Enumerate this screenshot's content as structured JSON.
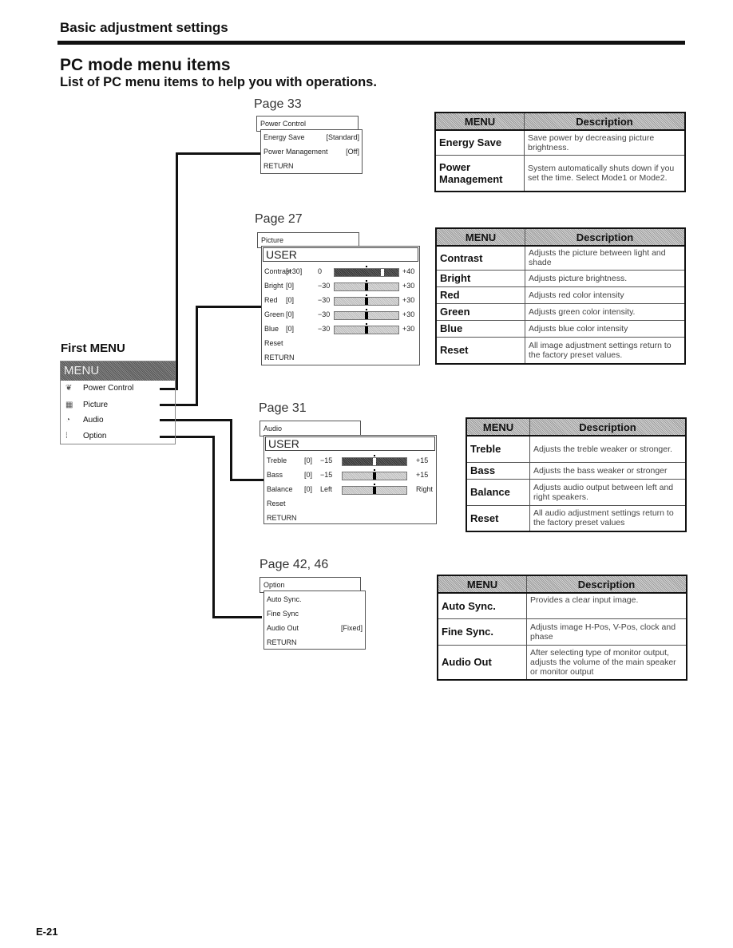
{
  "header": {
    "section": "Basic adjustment settings",
    "title": "PC mode menu items",
    "subtitle": "List of PC menu items to help you with operations."
  },
  "first_menu": {
    "label": "First MENU",
    "head": "MENU",
    "items": [
      {
        "icon": "power-control-icon",
        "glyph": "❦",
        "label": "Power Control"
      },
      {
        "icon": "picture-icon",
        "glyph": "▦",
        "label": "Picture"
      },
      {
        "icon": "audio-icon",
        "glyph": "◔",
        "label": "Audio"
      },
      {
        "icon": "option-icon",
        "glyph": "⁞",
        "label": "Option"
      }
    ]
  },
  "power_control": {
    "page": "Page 33",
    "title": "Power Control",
    "rows": [
      {
        "label": "Energy Save",
        "value": "[Standard]"
      },
      {
        "label": "Power Management",
        "value": "[Off]"
      },
      {
        "label": "RETURN",
        "value": ""
      }
    ],
    "table": {
      "headers": [
        "MENU",
        "Description"
      ],
      "rows": [
        {
          "menu": "Energy Save",
          "desc": "Save power by decreasing picture brightness."
        },
        {
          "menu": "Power Management",
          "desc": "System automatically shuts down if you set the time. Select Mode1 or Mode2."
        }
      ]
    }
  },
  "picture": {
    "page": "Page 27",
    "title": "Picture",
    "mode": "USER",
    "sliders": [
      {
        "label": "Contrast",
        "value": "[+30]",
        "min": "0",
        "max": "+40",
        "fraction": 0.75,
        "selected": true
      },
      {
        "label": "Bright",
        "value": "[0]",
        "min": "−30",
        "max": "+30",
        "fraction": 0.5,
        "selected": false
      },
      {
        "label": "Red",
        "value": "[0]",
        "min": "−30",
        "max": "+30",
        "fraction": 0.5,
        "selected": false
      },
      {
        "label": "Green",
        "value": "[0]",
        "min": "−30",
        "max": "+30",
        "fraction": 0.5,
        "selected": false
      },
      {
        "label": "Blue",
        "value": "[0]",
        "min": "−30",
        "max": "+30",
        "fraction": 0.5,
        "selected": false
      }
    ],
    "extra": [
      "Reset",
      "RETURN"
    ],
    "table": {
      "headers": [
        "MENU",
        "Description"
      ],
      "rows": [
        {
          "menu": "Contrast",
          "desc": "Adjusts the picture between light and shade"
        },
        {
          "menu": "Bright",
          "desc": "Adjusts picture brightness."
        },
        {
          "menu": "Red",
          "desc": "Adjusts red color intensity"
        },
        {
          "menu": "Green",
          "desc": "Adjusts green color intensity."
        },
        {
          "menu": "Blue",
          "desc": "Adjusts blue color intensity"
        },
        {
          "menu": "Reset",
          "desc": "All image adjustment settings return to the factory preset values."
        }
      ]
    }
  },
  "audio": {
    "page": "Page 31",
    "title": "Audio",
    "mode": "USER",
    "sliders": [
      {
        "label": "Treble",
        "value": "[0]",
        "min": "−15",
        "max": "+15",
        "fraction": 0.5,
        "selected": true
      },
      {
        "label": "Bass",
        "value": "[0]",
        "min": "−15",
        "max": "+15",
        "fraction": 0.5,
        "selected": false
      },
      {
        "label": "Balance",
        "value": "[0]",
        "min": "Left",
        "max": "Right",
        "fraction": 0.5,
        "selected": false
      }
    ],
    "extra": [
      "Reset",
      "RETURN"
    ],
    "table": {
      "headers": [
        "MENU",
        "Description"
      ],
      "rows": [
        {
          "menu": "Treble",
          "desc": "Adjusts the treble weaker or stronger."
        },
        {
          "menu": "Bass",
          "desc": "Adjusts the bass weaker or stronger"
        },
        {
          "menu": "Balance",
          "desc": "Adjusts audio output between left and right speakers."
        },
        {
          "menu": "Reset",
          "desc": "All audio adjustment settings return to the factory preset values"
        }
      ]
    }
  },
  "option": {
    "page": "Page 42, 46",
    "title": "Option",
    "rows": [
      {
        "label": "Auto Sync.",
        "value": ""
      },
      {
        "label": "Fine Sync",
        "value": ""
      },
      {
        "label": "Audio Out",
        "value": "[Fixed]"
      },
      {
        "label": "RETURN",
        "value": ""
      }
    ],
    "table": {
      "headers": [
        "MENU",
        "Description"
      ],
      "rows": [
        {
          "menu": "Auto Sync.",
          "desc": "Provides a clear input image."
        },
        {
          "menu": "Fine Sync.",
          "desc": "Adjusts image H-Pos, V-Pos, clock and phase"
        },
        {
          "menu": "Audio Out",
          "desc": "After selecting type of monitor output, adjusts the volume of the main speaker or monitor output"
        }
      ]
    }
  },
  "footer": {
    "page_number": "E-21"
  }
}
